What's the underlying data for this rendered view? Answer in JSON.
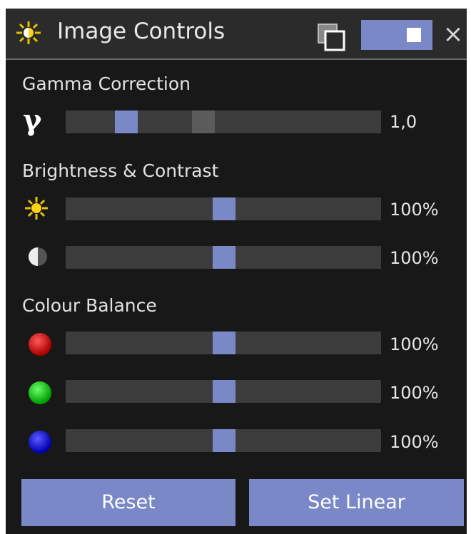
{
  "window": {
    "title": "Image Controls",
    "icons": {
      "title": "sun-icon",
      "restore": "restore-window-icon",
      "close": "close-icon"
    },
    "close_label": "×",
    "accent_color": "#7a88c8"
  },
  "gamma": {
    "section_title": "Gamma Correction",
    "icon": "gamma-icon",
    "symbol": "γ",
    "value_text": "1,0"
  },
  "brightness_contrast": {
    "section_title": "Brightness & Contrast",
    "brightness": {
      "icon": "sun-icon",
      "value_text": "100%",
      "level": 0.5
    },
    "contrast": {
      "icon": "contrast-icon",
      "value_text": "100%",
      "level": 0.5
    }
  },
  "colour_balance": {
    "section_title": "Colour Balance",
    "red": {
      "icon": "red-ball-icon",
      "value_text": "100%",
      "level": 0.5
    },
    "green": {
      "icon": "green-ball-icon",
      "value_text": "100%",
      "level": 0.5
    },
    "blue": {
      "icon": "blue-ball-icon",
      "value_text": "100%",
      "level": 0.5
    }
  },
  "buttons": {
    "reset": "Reset",
    "set_linear": "Set Linear"
  }
}
